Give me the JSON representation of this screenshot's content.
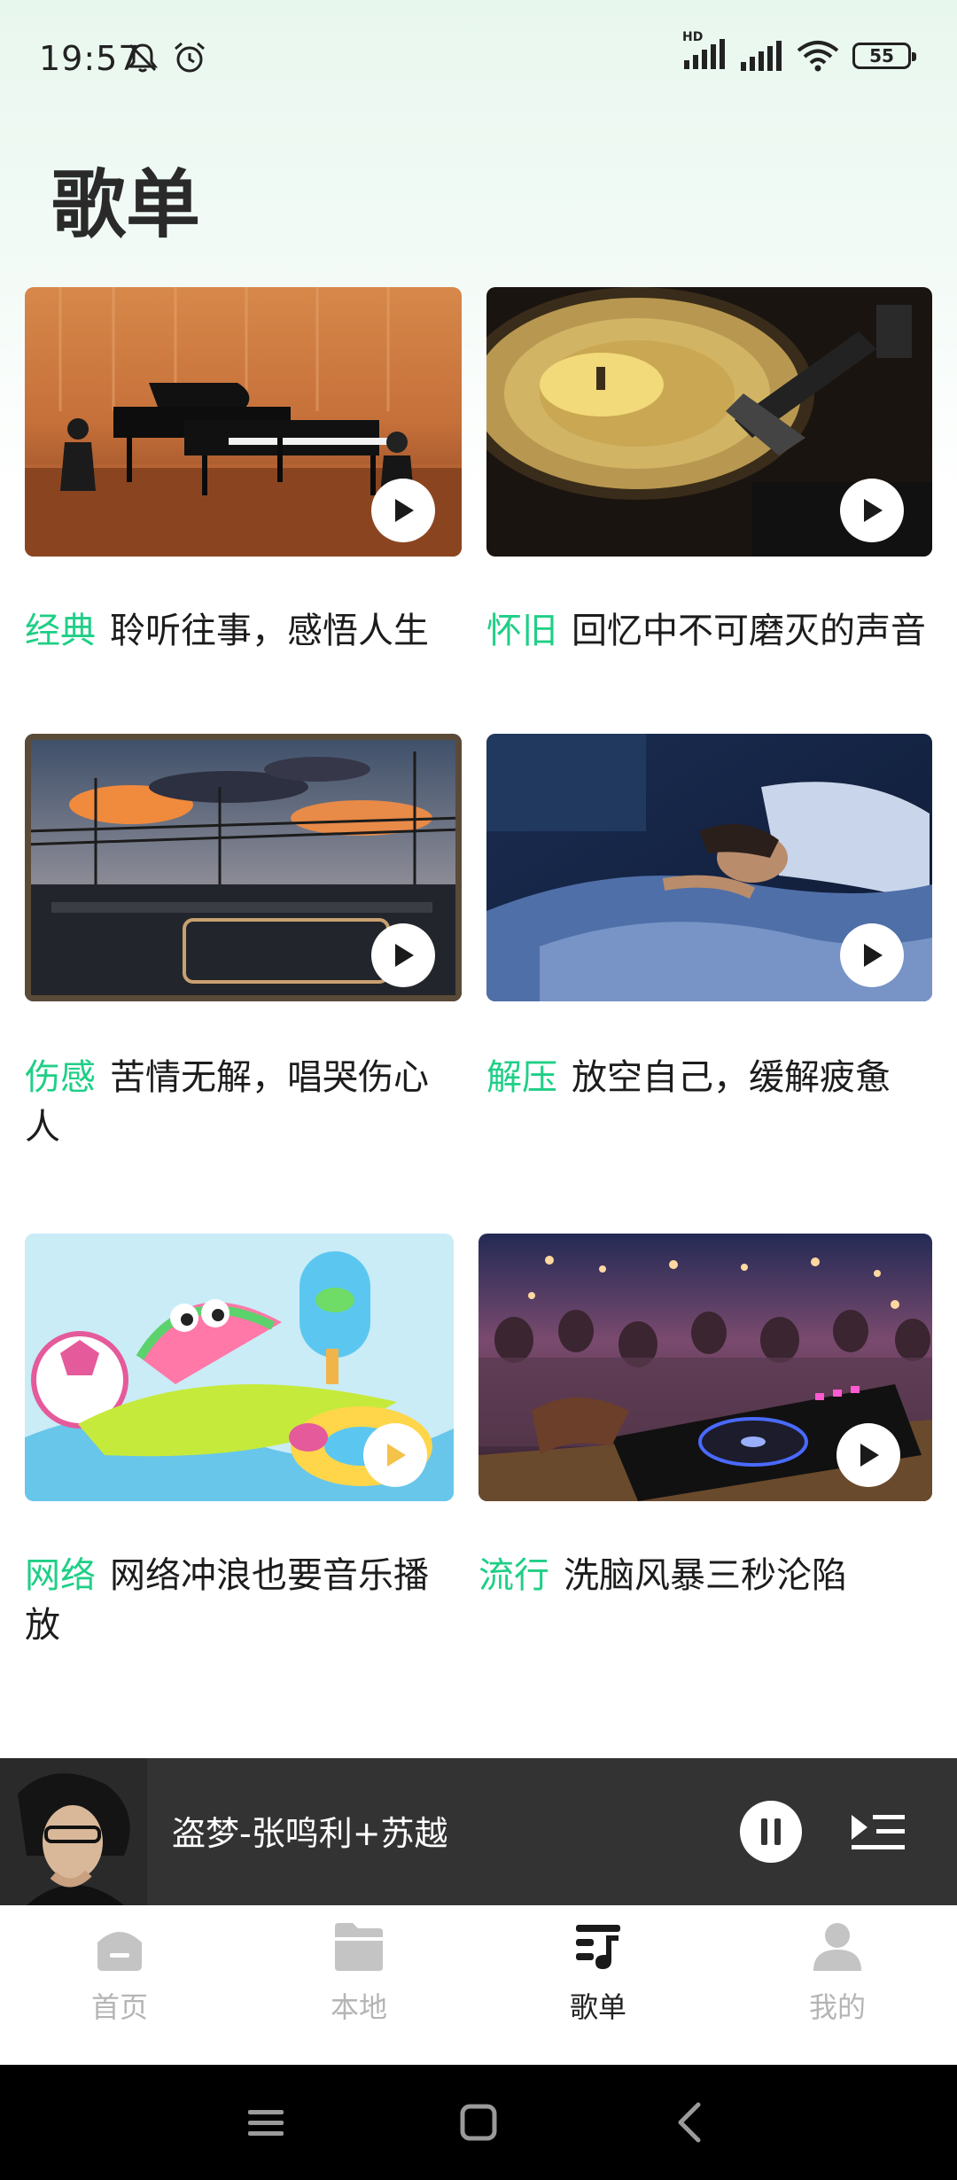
{
  "status_bar": {
    "time": "19:57",
    "network": "HD",
    "battery": "55",
    "icons": [
      "mute-icon",
      "alarm-icon",
      "signal-icon",
      "signal-icon",
      "wifi-icon",
      "battery-icon"
    ]
  },
  "page": {
    "title": "歌单"
  },
  "playlists": [
    {
      "tag": "经典",
      "desc": "聆听往事，感悟人生",
      "image": "concert-pianos",
      "icon": "play-icon"
    },
    {
      "tag": "怀旧",
      "desc": "回忆中不可磨灭的声音",
      "image": "vinyl-record",
      "icon": "play-icon"
    },
    {
      "tag": "伤感",
      "desc": "苦情无解，唱哭伤心人",
      "image": "sunset-window",
      "icon": "play-icon"
    },
    {
      "tag": "解压",
      "desc": "放空自己，缓解疲惫",
      "image": "sleeping-woman",
      "icon": "play-icon"
    },
    {
      "tag": "网络",
      "desc": "网络冲浪也要音乐播放",
      "image": "cartoon-watermelon",
      "icon": "play-icon"
    },
    {
      "tag": "流行",
      "desc": "洗脑风暴三秒沦陷",
      "image": "dj-party",
      "icon": "play-icon"
    }
  ],
  "mini_player": {
    "title": "盗梦-张鸣利+苏越",
    "cover": "artist-avatar",
    "icons": [
      "pause-icon",
      "queue-icon"
    ]
  },
  "bottom_nav": {
    "items": [
      {
        "label": "首页",
        "icon": "home-icon",
        "active": false
      },
      {
        "label": "本地",
        "icon": "folder-icon",
        "active": false
      },
      {
        "label": "歌单",
        "icon": "playlist-icon",
        "active": true
      },
      {
        "label": "我的",
        "icon": "profile-icon",
        "active": false
      }
    ]
  },
  "colors": {
    "accent": "#1fcf86",
    "player_bg": "#333333",
    "inactive": "#b5b5b5"
  }
}
